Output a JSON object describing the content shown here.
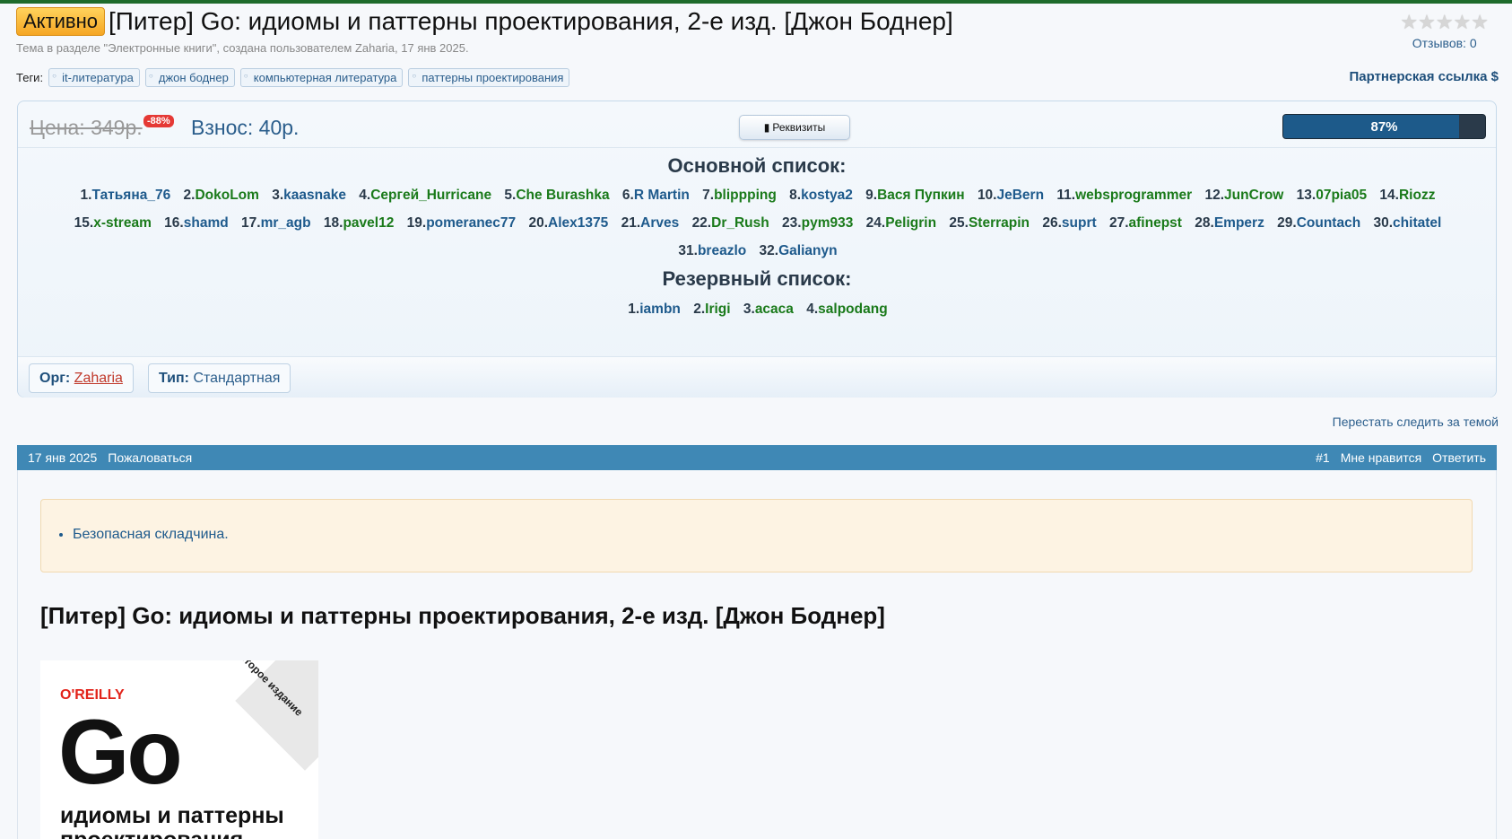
{
  "header": {
    "status": "Активно",
    "title": "[Питер] Go: идиомы и паттерны проектирования, 2-е изд. [Джон Боднер]",
    "meta": "Тема в разделе \"Электронные книги\", создана пользователем Zaharia, 17 янв 2025.",
    "stars": "★★★★★",
    "reviews": "Отзывов: 0",
    "tags_label": "Теги:",
    "tags": [
      "it-литература",
      "джон боднер",
      "компьютерная литература",
      "паттерны проектирования"
    ],
    "partner_link": "Партнерская ссылка $"
  },
  "fund": {
    "price": "Цена: 349р.",
    "discount": "-88%",
    "fee": "Взнос: 40р.",
    "details_button": "Реквизиты",
    "progress_text": "87%",
    "progress_value": 0.87,
    "main_list_title": "Основной список:",
    "main_list": [
      {
        "n": "1.",
        "nick": "Татьяна_76",
        "c": "blue"
      },
      {
        "n": "2.",
        "nick": "DokoLom",
        "c": "green"
      },
      {
        "n": "3.",
        "nick": "kaasnake",
        "c": "blue"
      },
      {
        "n": "4.",
        "nick": "Сергей_Hurricane",
        "c": "green"
      },
      {
        "n": "5.",
        "nick": "Che Burashka",
        "c": "green"
      },
      {
        "n": "6.",
        "nick": "R Martin",
        "c": "blue"
      },
      {
        "n": "7.",
        "nick": "blippping",
        "c": "green"
      },
      {
        "n": "8.",
        "nick": "kostya2",
        "c": "blue"
      },
      {
        "n": "9.",
        "nick": "Вася Пупкин",
        "c": "green"
      },
      {
        "n": "10.",
        "nick": "JeBern",
        "c": "blue"
      },
      {
        "n": "11.",
        "nick": "websprogrammer",
        "c": "green"
      },
      {
        "n": "12.",
        "nick": "JunCrow",
        "c": "green"
      },
      {
        "n": "13.",
        "nick": "07pia05",
        "c": "green"
      },
      {
        "n": "14.",
        "nick": "Riozz",
        "c": "green"
      },
      {
        "n": "15.",
        "nick": "x-stream",
        "c": "green"
      },
      {
        "n": "16.",
        "nick": "shamd",
        "c": "blue"
      },
      {
        "n": "17.",
        "nick": "mr_agb",
        "c": "blue"
      },
      {
        "n": "18.",
        "nick": "pavel12",
        "c": "green"
      },
      {
        "n": "19.",
        "nick": "pomeranec77",
        "c": "blue"
      },
      {
        "n": "20.",
        "nick": "Alex1375",
        "c": "blue"
      },
      {
        "n": "21.",
        "nick": "Arves",
        "c": "blue"
      },
      {
        "n": "22.",
        "nick": "Dr_Rush",
        "c": "green"
      },
      {
        "n": "23.",
        "nick": "pym933",
        "c": "green"
      },
      {
        "n": "24.",
        "nick": "Peligrin",
        "c": "green"
      },
      {
        "n": "25.",
        "nick": "Sterrapin",
        "c": "green"
      },
      {
        "n": "26.",
        "nick": "suprt",
        "c": "blue"
      },
      {
        "n": "27.",
        "nick": "afinepst",
        "c": "green"
      },
      {
        "n": "28.",
        "nick": "Emperz",
        "c": "blue"
      },
      {
        "n": "29.",
        "nick": "Countach",
        "c": "blue"
      },
      {
        "n": "30.",
        "nick": "chitatel",
        "c": "blue"
      },
      {
        "n": "31.",
        "nick": "breazlo",
        "c": "blue"
      },
      {
        "n": "32.",
        "nick": "Galianyn",
        "c": "blue"
      }
    ],
    "reserve_list_title": "Резервный список:",
    "reserve_list": [
      {
        "n": "1.",
        "nick": "iambn",
        "c": "blue"
      },
      {
        "n": "2.",
        "nick": "Irigi",
        "c": "green"
      },
      {
        "n": "3.",
        "nick": "acaca",
        "c": "green"
      },
      {
        "n": "4.",
        "nick": "salpodang",
        "c": "green"
      }
    ],
    "org_label": "Орг:",
    "org_value": "Zaharia",
    "type_label": "Тип:",
    "type_value": "Стандартная"
  },
  "unwatch": "Перестать следить за темой",
  "post": {
    "date": "17 янв 2025",
    "report": "Пожаловаться",
    "number": "#1",
    "like": "Мне нравится",
    "reply": "Ответить",
    "notice": "Безопасная складчина.",
    "title": "[Питер] Go: идиомы и паттерны проектирования, 2-е изд. [Джон Боднер]",
    "cover": {
      "edition": "Второе издание",
      "publisher": "O'REILLY",
      "logo": "Go",
      "subtitle": "идиомы и паттерны проектирования"
    }
  },
  "colors": {
    "accent": "#3f88b5",
    "link_blue": "#1e5a8c",
    "link_green": "#1a7a1a",
    "top_border": "#1e6b2c"
  }
}
